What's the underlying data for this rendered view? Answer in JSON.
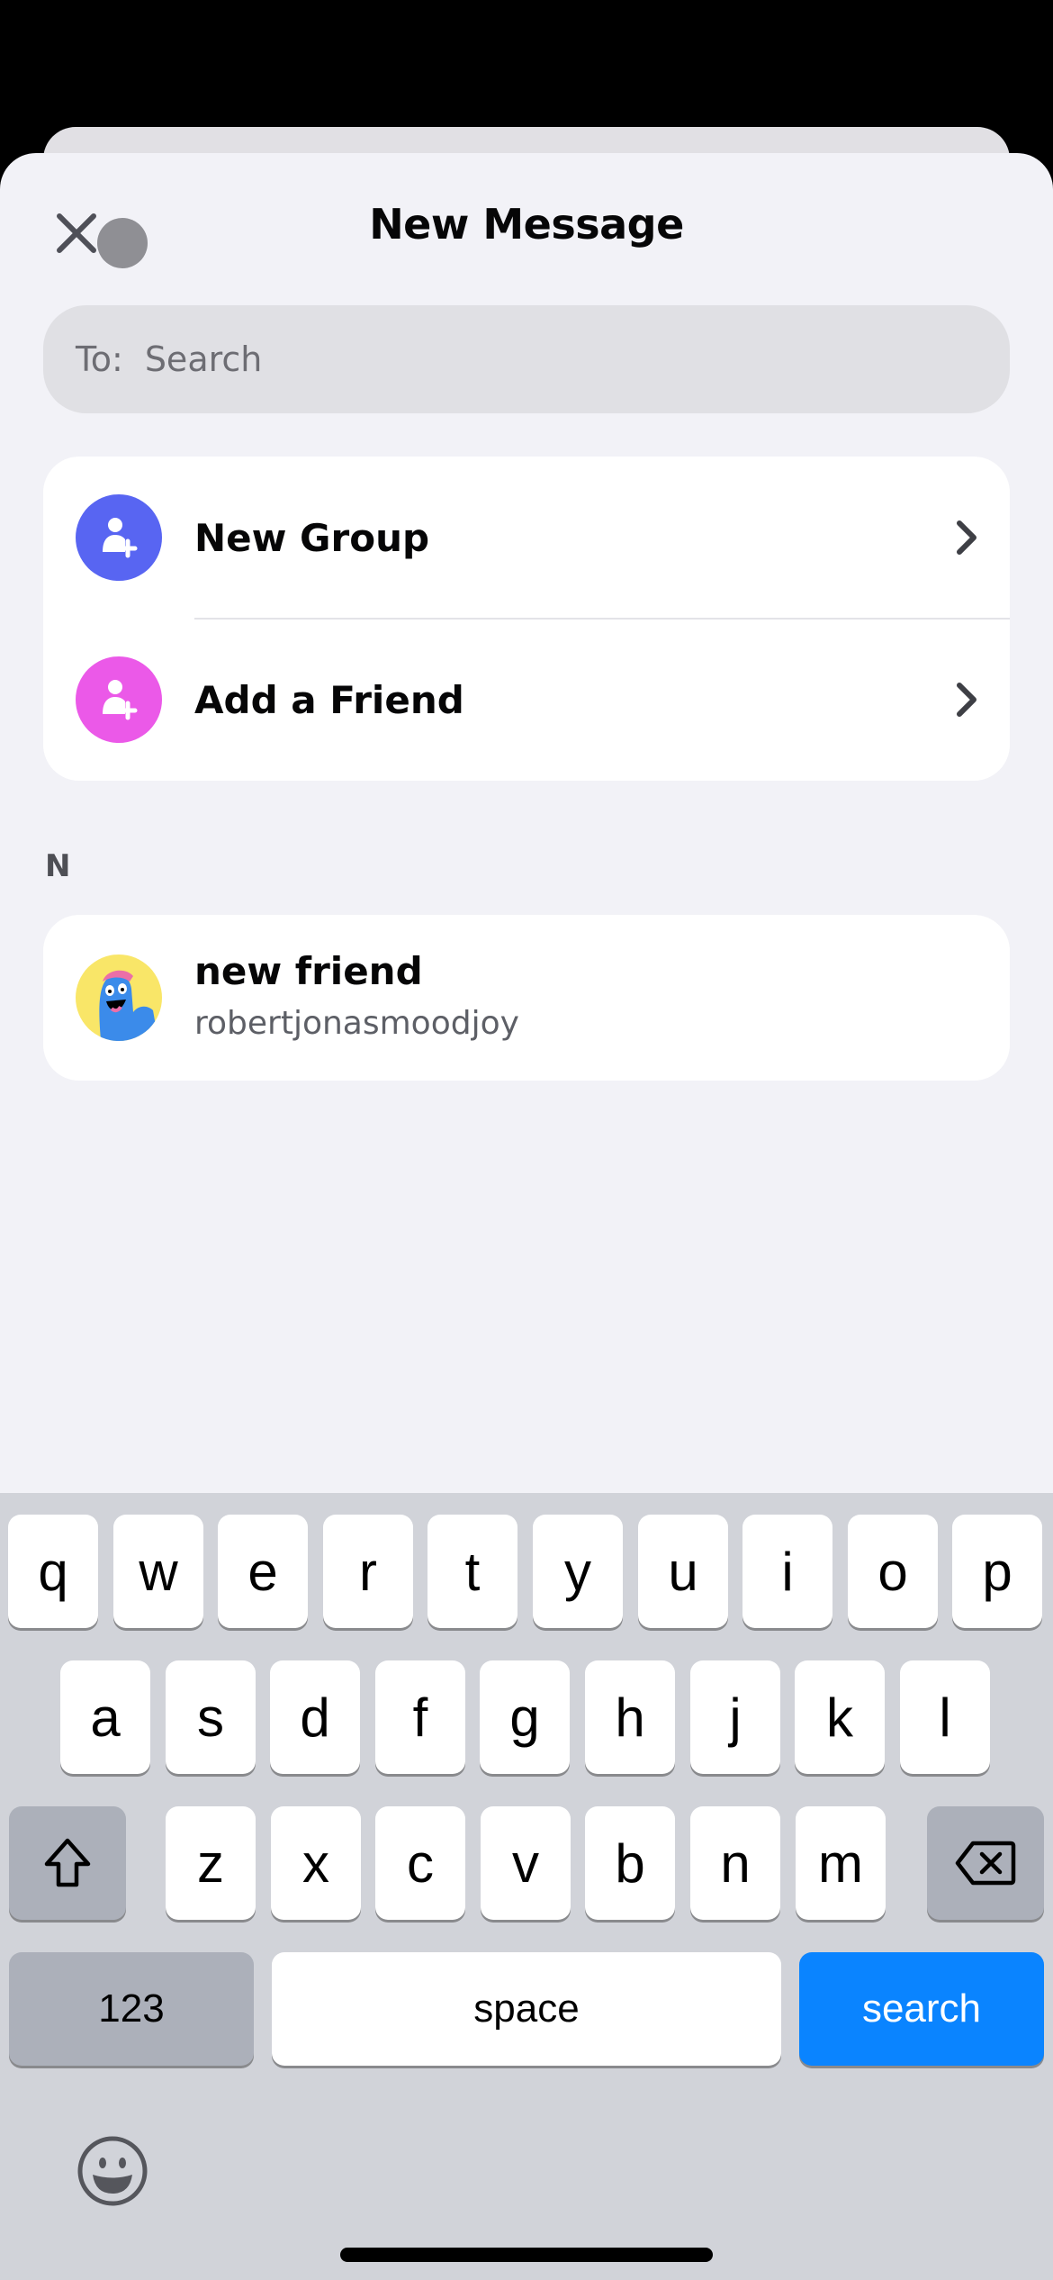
{
  "header": {
    "title": "New Message",
    "close_icon": "close-icon"
  },
  "search": {
    "prefix": "To:",
    "placeholder": "Search",
    "value": ""
  },
  "actions": [
    {
      "label": "New Group",
      "icon": "add-user-icon",
      "color": "#5865f2"
    },
    {
      "label": "Add a Friend",
      "icon": "add-user-icon",
      "color": "#eb59e8"
    }
  ],
  "friends_section": {
    "letter": "N",
    "items": [
      {
        "display_name": "new friend",
        "username": "robertjonasmoodjoy"
      }
    ]
  },
  "keyboard": {
    "row1": [
      "q",
      "w",
      "e",
      "r",
      "t",
      "y",
      "u",
      "i",
      "o",
      "p"
    ],
    "row2": [
      "a",
      "s",
      "d",
      "f",
      "g",
      "h",
      "j",
      "k",
      "l"
    ],
    "row3": [
      "z",
      "x",
      "c",
      "v",
      "b",
      "n",
      "m"
    ],
    "numbers_label": "123",
    "space_label": "space",
    "action_label": "search",
    "action_color": "#0a84ff"
  }
}
